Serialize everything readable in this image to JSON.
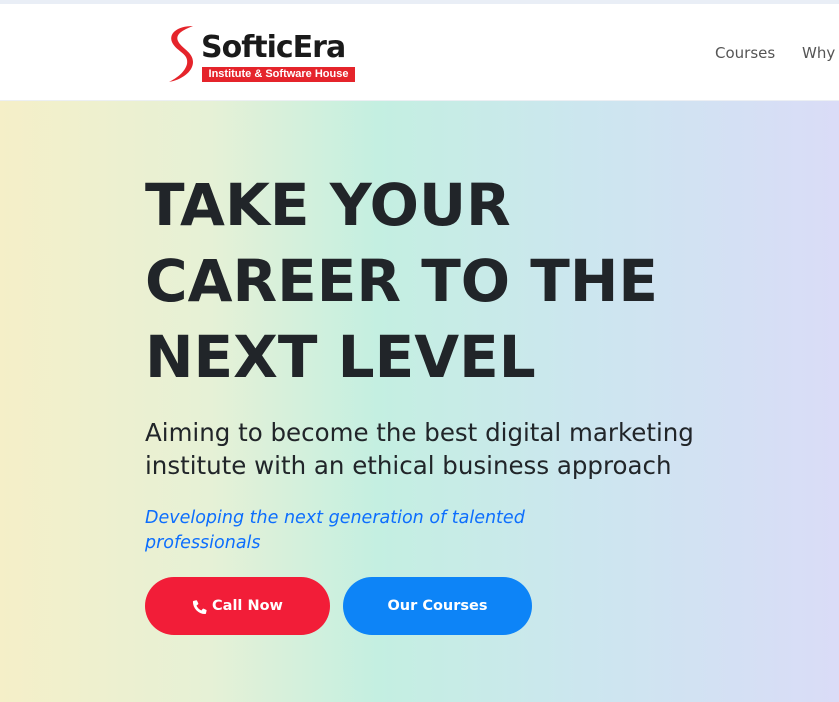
{
  "header": {
    "logo": {
      "name": "SofticEra",
      "subtitle": "Institute & Software House",
      "icon": "s-swoosh-logo",
      "brand_color": "#e5242b"
    },
    "nav": [
      {
        "label": "Courses"
      },
      {
        "label": "Why"
      }
    ]
  },
  "hero": {
    "headline_lines": [
      "TAKE YOUR",
      "CAREER TO THE",
      "NEXT LEVEL"
    ],
    "subheading_lines": [
      "Aiming to become the best digital marketing",
      "institute with an ethical business approach"
    ],
    "tagline_lines": [
      "Developing the next generation of talented",
      "professionals"
    ],
    "buttons": {
      "call": {
        "label": "Call Now",
        "icon": "phone-icon",
        "color": "#f21d38"
      },
      "courses": {
        "label": "Our Courses",
        "color": "#0d84f7"
      }
    },
    "colors": {
      "text": "#212529",
      "tagline": "#0d6efd"
    }
  }
}
